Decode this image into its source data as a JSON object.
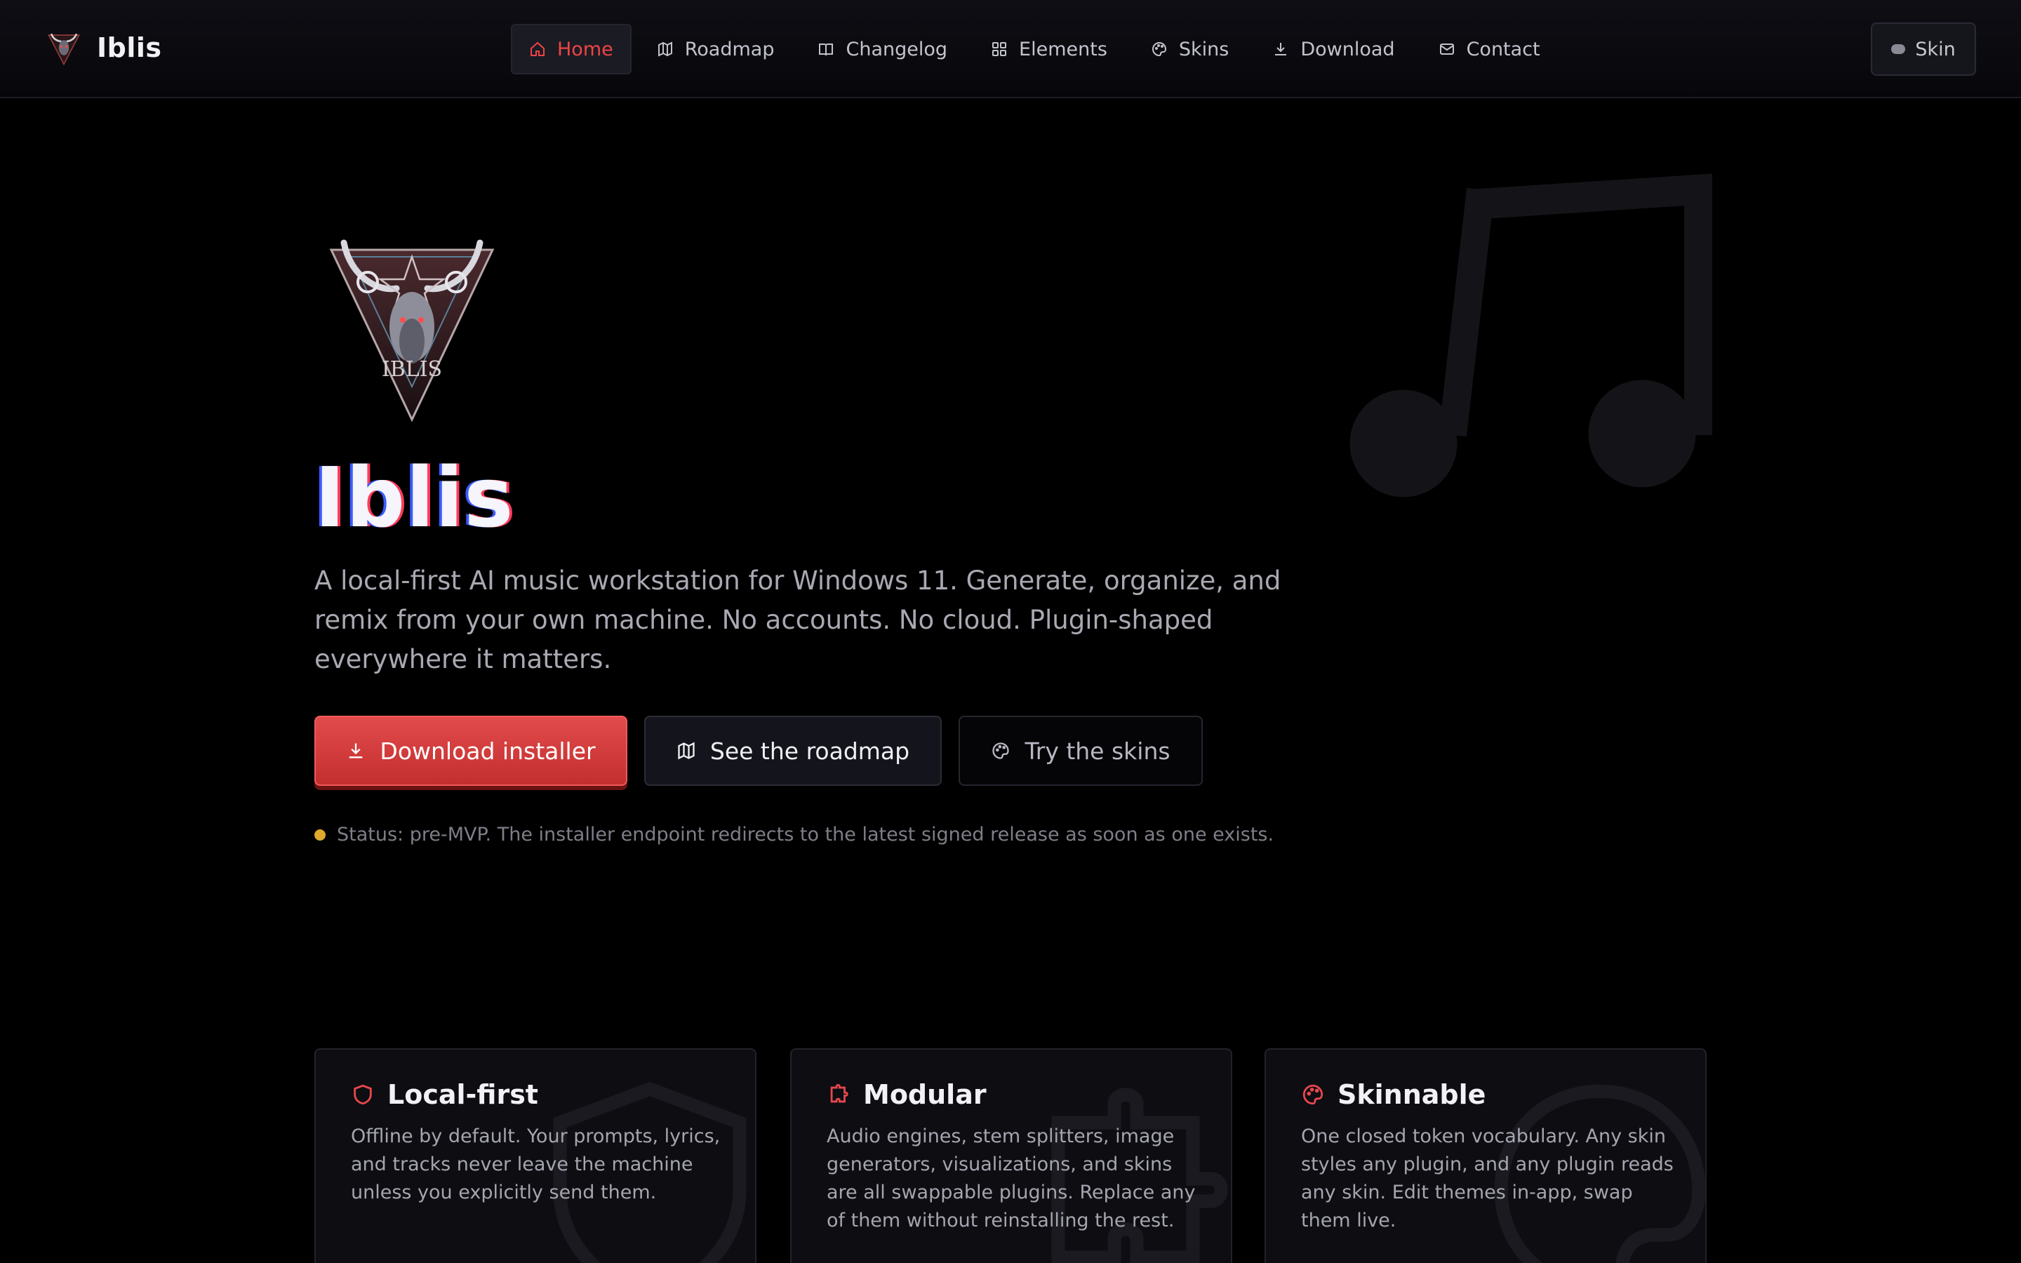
{
  "brand": {
    "name": "Iblis"
  },
  "nav": {
    "items": [
      {
        "label": "Home",
        "icon": "home-icon",
        "active": true
      },
      {
        "label": "Roadmap",
        "icon": "map-icon"
      },
      {
        "label": "Changelog",
        "icon": "book-icon"
      },
      {
        "label": "Elements",
        "icon": "grid-icon"
      },
      {
        "label": "Skins",
        "icon": "palette-icon"
      },
      {
        "label": "Download",
        "icon": "download-icon"
      },
      {
        "label": "Contact",
        "icon": "mail-icon"
      }
    ],
    "skin_button": "Skin"
  },
  "hero": {
    "logo_text": "IBLIS",
    "title": "Iblis",
    "description": "A local-first AI music workstation for Windows 11. Generate, organize, and remix from your own machine. No accounts. No cloud. Plugin-shaped everywhere it matters.",
    "buttons": {
      "download": "Download installer",
      "roadmap": "See the roadmap",
      "skins": "Try the skins"
    },
    "status": "Status: pre-MVP. The installer endpoint redirects to the latest signed release as soon as one exists."
  },
  "features": [
    {
      "icon": "shield-icon",
      "title": "Local-first",
      "text": "Offline by default. Your prompts, lyrics, and tracks never leave the machine unless you explicitly send them."
    },
    {
      "icon": "puzzle-icon",
      "title": "Modular",
      "text": "Audio engines, stem splitters, image generators, visualizations, and skins are all swappable plugins. Replace any of them without reinstalling the rest."
    },
    {
      "icon": "palette-icon",
      "title": "Skinnable",
      "text": "One closed token vocabulary. Any skin styles any plugin, and any plugin reads any skin. Edit themes in-app, swap them live."
    }
  ],
  "colors": {
    "accent": "#e5484d",
    "background": "#000000",
    "status_dot": "#e0a82e"
  }
}
